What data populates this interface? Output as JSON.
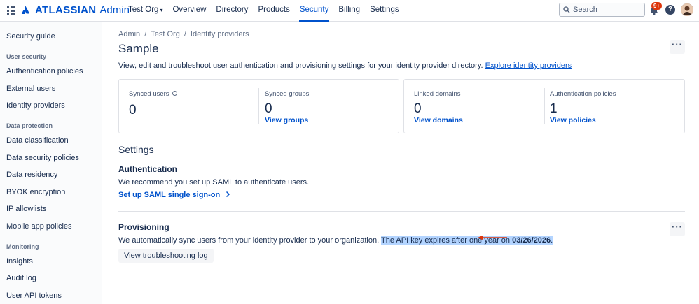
{
  "topbar": {
    "brand": "ATLASSIAN",
    "product": "Admin",
    "org_switcher": "Test Org",
    "nav": [
      "Overview",
      "Directory",
      "Products",
      "Security",
      "Billing",
      "Settings"
    ],
    "active_nav": "Security",
    "search_placeholder": "Search",
    "notification_count": "9+",
    "help_label": "?"
  },
  "sidebar": {
    "top_item": "Security guide",
    "groups": [
      {
        "heading": "User security",
        "items": [
          "Authentication policies",
          "External users",
          "Identity providers"
        ]
      },
      {
        "heading": "Data protection",
        "items": [
          "Data classification",
          "Data security policies",
          "Data residency",
          "BYOK encryption",
          "IP allowlists",
          "Mobile app policies"
        ]
      },
      {
        "heading": "Monitoring",
        "items": [
          "Insights",
          "Audit log",
          "User API tokens"
        ]
      }
    ]
  },
  "breadcrumb": [
    "Admin",
    "Test Org",
    "Identity providers"
  ],
  "page": {
    "title": "Sample",
    "description": "View, edit and troubleshoot user authentication and provisioning settings for your identity provider directory.",
    "description_link": "Explore identity providers"
  },
  "stats": [
    {
      "label": "Synced users",
      "value": "0",
      "link": ""
    },
    {
      "label": "Synced groups",
      "value": "0",
      "link": "View groups"
    },
    {
      "label": "Linked domains",
      "value": "0",
      "link": "View domains"
    },
    {
      "label": "Authentication policies",
      "value": "1",
      "link": "View policies"
    }
  ],
  "settings": {
    "title": "Settings",
    "authentication": {
      "title": "Authentication",
      "text": "We recommend you set up SAML to authenticate users.",
      "link": "Set up SAML single sign-on"
    },
    "provisioning": {
      "title": "Provisioning",
      "text": "We automatically sync users from your identity provider to your organization.",
      "highlight_text": "The API key expires after one year on ",
      "highlight_date": "03/26/2026",
      "highlight_end": ".",
      "button": "View troubleshooting log"
    }
  },
  "colors": {
    "accent": "#0052cc",
    "highlight": "#b3d4ff",
    "annotation_arrow": "#de350b",
    "badge": "#de350b"
  }
}
